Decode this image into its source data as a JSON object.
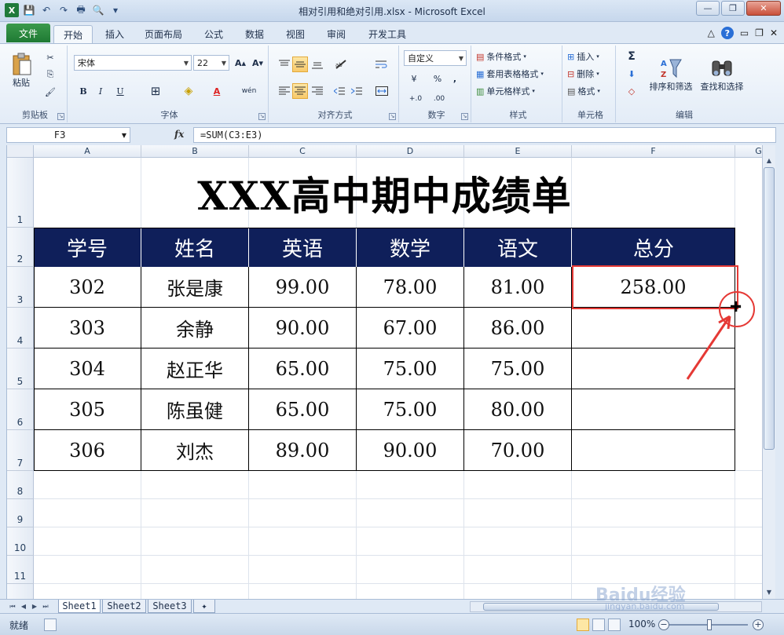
{
  "window": {
    "title": "相对引用和绝对引用.xlsx - Microsoft Excel",
    "logo": "X",
    "min_glyph": "—",
    "restore_glyph": "❐",
    "close_glyph": "✕"
  },
  "qat": {
    "save": "💾",
    "undo": "↶",
    "redo": "↷",
    "print": "🖶",
    "preview": "🔍",
    "more": "▾"
  },
  "tabs": {
    "file": "文件",
    "items": [
      "开始",
      "插入",
      "页面布局",
      "公式",
      "数据",
      "视图",
      "审阅",
      "开发工具"
    ]
  },
  "tabs_right": {
    "caret": "△",
    "help": "?",
    "min": "▭",
    "restore": "❐",
    "close": "✕"
  },
  "ribbon": {
    "clipboard": {
      "label": "剪贴板",
      "paste": "粘贴",
      "cut": "✂",
      "copy": "⎘",
      "format_painter": "🖌"
    },
    "font": {
      "label": "字体",
      "font_name": "宋体",
      "font_size": "22",
      "grow": "A▴",
      "shrink": "A▾",
      "bold": "B",
      "italic": "I",
      "underline": "U",
      "border": "⊞",
      "fill": "◈",
      "color": "A",
      "wen": "wén"
    },
    "alignment": {
      "label": "对齐方式"
    },
    "number": {
      "label": "数字",
      "format": "自定义",
      "currency": "¥",
      "percent": "%",
      "comma": ",",
      "inc": "+.0",
      "dec": ".00"
    },
    "styles": {
      "label": "样式",
      "conditional": "条件格式",
      "table": "套用表格格式",
      "cell": "单元格样式"
    },
    "cells": {
      "label": "单元格",
      "insert": "插入",
      "delete": "删除",
      "format": "格式"
    },
    "editing": {
      "label": "编辑",
      "sum": "Σ",
      "fill": "⬇",
      "clear": "◇",
      "sort": "排序和筛选",
      "find": "查找和选择"
    }
  },
  "formula_bar": {
    "name": "F3",
    "fx": "fx",
    "formula": "=SUM(C3:E3)"
  },
  "columns": [
    "A",
    "B",
    "C",
    "D",
    "E",
    "F",
    "G"
  ],
  "rows": [
    "1",
    "2",
    "3",
    "4",
    "5",
    "6",
    "7",
    "8",
    "9",
    "10",
    "11"
  ],
  "sheet": {
    "title": "XXX高中期中成绩单",
    "headers": [
      "学号",
      "姓名",
      "英语",
      "数学",
      "语文",
      "总分"
    ],
    "data": [
      [
        "302",
        "张是康",
        "99.00",
        "78.00",
        "81.00",
        "258.00"
      ],
      [
        "303",
        "余静",
        "90.00",
        "67.00",
        "86.00",
        ""
      ],
      [
        "304",
        "赵正华",
        "65.00",
        "75.00",
        "75.00",
        ""
      ],
      [
        "305",
        "陈虽健",
        "65.00",
        "75.00",
        "80.00",
        ""
      ],
      [
        "306",
        "刘杰",
        "89.00",
        "90.00",
        "70.00",
        ""
      ]
    ]
  },
  "sheet_tabs": [
    "Sheet1",
    "Sheet2",
    "Sheet3"
  ],
  "status": {
    "ready": "就绪",
    "zoom": "100%"
  },
  "watermark": {
    "brand": "Baidu经验",
    "url": "jingyan.baidu.com"
  },
  "colors": {
    "header_bg": "#0f1f5a",
    "highlight": "#e53935",
    "file_tab": "#1f7a34"
  }
}
